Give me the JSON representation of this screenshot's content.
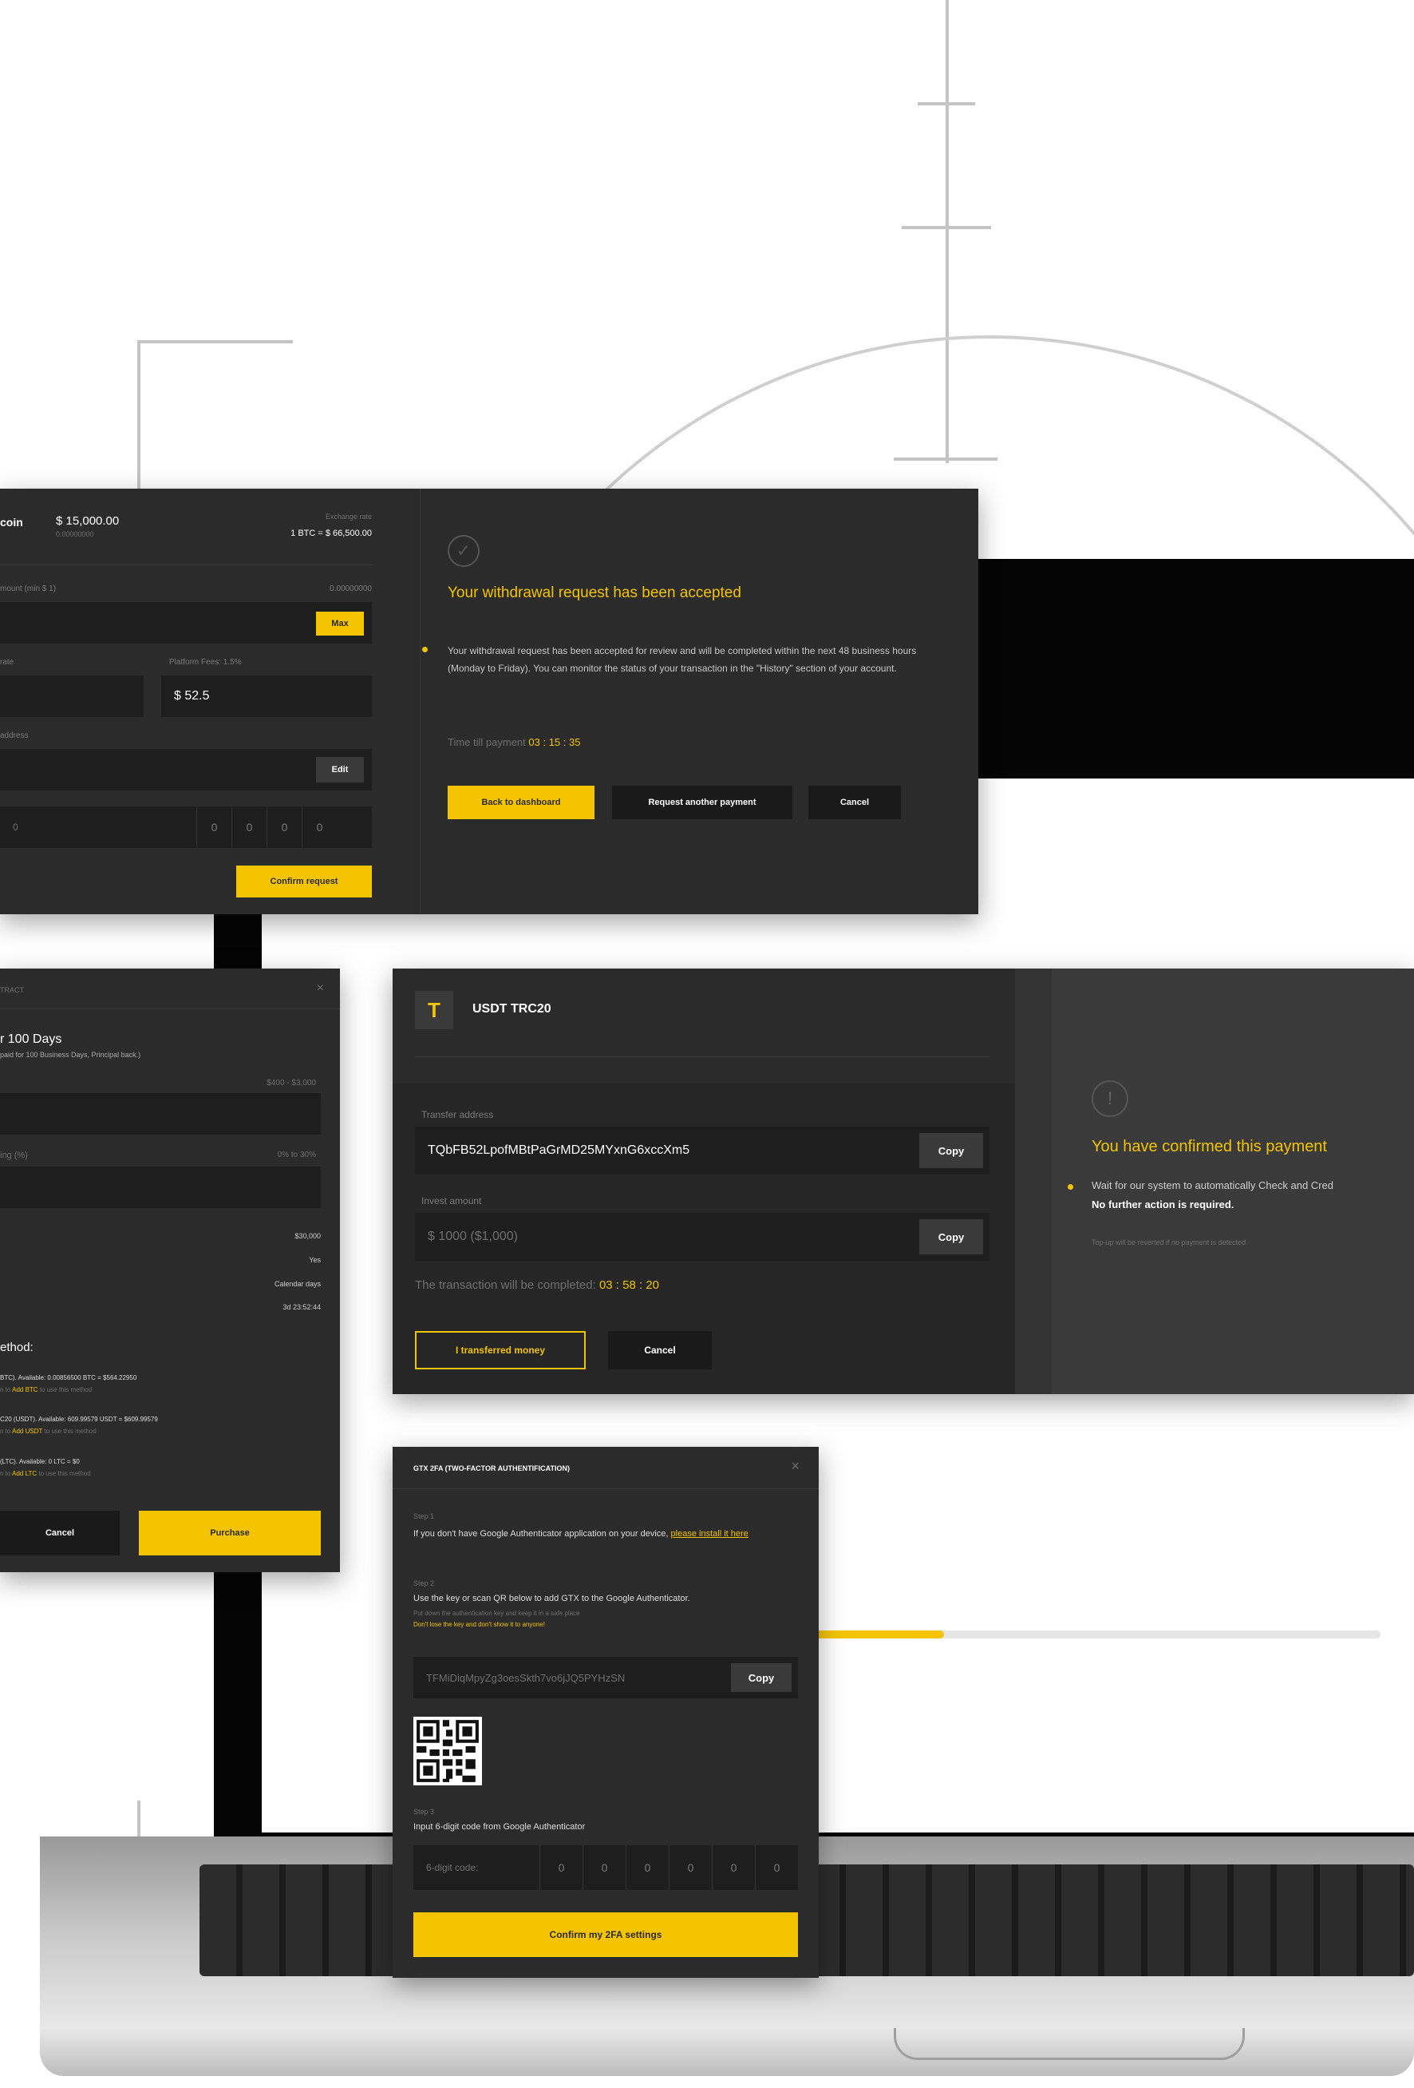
{
  "colors": {
    "accent": "#f5c400",
    "panel": "#2b2b2b",
    "field": "#1e1e1e"
  },
  "progress": {
    "value": 0.25
  },
  "withdraw": {
    "coin": "coin",
    "balance": "$ 15,000.00",
    "balance_sub": "0.00000000",
    "exchange_label": "Exchange rate",
    "exchange_value": "1 BTC = $ 66,500.00",
    "amount_label": "mount (min $ 1)",
    "amount_right": "0.00000000",
    "max_label": "Max",
    "rate_label": "rate",
    "fees_label": "Platform Fees: 1.5%",
    "fees_value": "$ 52.5",
    "address_label": "address",
    "edit_label": "Edit",
    "otp": [
      "0",
      "0",
      "0",
      "0"
    ],
    "confirm_label": "Confirm request",
    "accepted_title": "Your withdrawal request has been accepted",
    "accepted_text": "Your withdrawal request has been accepted for review and will be completed within the next 48 business hours (Monday to Friday). You can monitor the status of your transaction in the \"History\" section of your account.",
    "timer_label": "Time till payment",
    "timer_value": "03 : 15 : 35",
    "back_label": "Back to dashboard",
    "another_label": "Request another payment",
    "cancel_label": "Cancel"
  },
  "contract": {
    "header": "TRACT",
    "title": "r 100 Days",
    "subtitle": "paid for 100 Business Days, Principal back.)",
    "range1": "$400 - $3,000",
    "label2": "ing (%)",
    "range2": "0% to 30%",
    "rows": [
      {
        "value": "$30,000"
      },
      {
        "value": "Yes"
      },
      {
        "value": "Calendar days"
      },
      {
        "value": "3d 23:52:44"
      }
    ],
    "method_label": "ethod:",
    "methods": [
      {
        "line": "BTC). Available: 0.00856500 BTC = $564.22950",
        "add": "Add BTC",
        "hint": "to use this method"
      },
      {
        "line": "C20 (USDT). Available: 609.99579 USDT = $609.99579",
        "add": "Add USDT",
        "hint": "to use this method"
      },
      {
        "line": "(LTC). Available: 0 LTC = $0",
        "add": "Add LTC",
        "hint": "to use this method"
      }
    ],
    "cancel_label": "Cancel",
    "purchase_label": "Purchase",
    "close_label": "×"
  },
  "usdt": {
    "icon_letter": "T",
    "title": "USDT TRC20",
    "address_label": "Transfer address",
    "address_value": "TQbFB52LpofMBtPaGrMD25MYxnG6xccXm5",
    "invest_label": "Invest amount",
    "invest_value": "$ 1000 ($1,000)",
    "copy_label": "Copy",
    "complete_label": "The transaction will be completed:",
    "complete_timer": "03 : 58 : 20",
    "transferred_label": "I transferred money",
    "cancel_label": "Cancel",
    "confirmed_title": "You have confirmed this payment",
    "confirmed_text": "Wait for our system to automatically Check and Cred",
    "confirmed_bold": "No further action is required.",
    "confirmed_hint": "Top-up will be reverted if no payment is detected"
  },
  "twofa": {
    "title": "GTX 2FA (TWO-FACTOR AUTHENTIFICATION)",
    "close_label": "×",
    "step1": "Step 1",
    "step1_text": "If you don't have Google Authenticator application on your device,",
    "step1_link": "please install it here",
    "step2": "Step 2",
    "step2_text": "Use the key or scan QR below to add GTX to the Google Authenticator.",
    "step2_hint": "Put down the authentication key and keep it in a safe place",
    "step2_warn": "Don't lose the key and don't show it to anyone!",
    "key": "TFMiDiqMpyZg3oesSkth7vo6jJQ5PYHzSN",
    "copy_label": "Copy",
    "step3": "Step 3",
    "step3_text": "Input 6-digit code from Google Authenticator",
    "code_placeholder": "6-digit code:",
    "otp": [
      "0",
      "0",
      "0",
      "0",
      "0",
      "0"
    ],
    "confirm_label": "Confirm my 2FA settings"
  }
}
